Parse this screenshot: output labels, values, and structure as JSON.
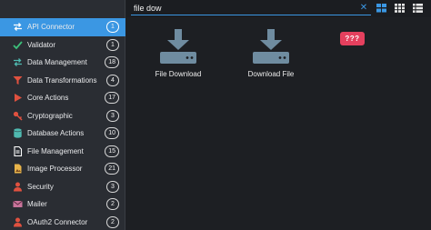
{
  "sidebar": {
    "items": [
      {
        "label": "API Connector",
        "count": "1",
        "icon": "swap-arrows-icon",
        "color": "#ffffff",
        "active": true
      },
      {
        "label": "Validator",
        "count": "1",
        "icon": "checkmark-icon",
        "color": "#3cbf7a"
      },
      {
        "label": "Data Management",
        "count": "18",
        "icon": "swap-arrows-icon",
        "color": "#4fb9b0"
      },
      {
        "label": "Data Transformations",
        "count": "4",
        "icon": "funnel-icon",
        "color": "#e0513f"
      },
      {
        "label": "Core Actions",
        "count": "17",
        "icon": "play-icon",
        "color": "#e0513f"
      },
      {
        "label": "Cryptographic",
        "count": "3",
        "icon": "key-icon",
        "color": "#e0513f"
      },
      {
        "label": "Database Actions",
        "count": "10",
        "icon": "database-icon",
        "color": "#4fb9b0"
      },
      {
        "label": "File Management",
        "count": "15",
        "icon": "file-icon",
        "color": "#ffffff"
      },
      {
        "label": "Image Processor",
        "count": "21",
        "icon": "image-file-icon",
        "color": "#e8b44a"
      },
      {
        "label": "Security",
        "count": "3",
        "icon": "user-icon",
        "color": "#e0513f"
      },
      {
        "label": "Mailer",
        "count": "2",
        "icon": "envelope-icon",
        "color": "#c8739a"
      },
      {
        "label": "OAuth2 Connector",
        "count": "2",
        "icon": "user-icon",
        "color": "#e0513f"
      }
    ]
  },
  "search": {
    "value": "file dow",
    "clear_icon": "close-icon"
  },
  "views": [
    "grid-large-icon",
    "grid-small-icon",
    "list-icon"
  ],
  "results": [
    {
      "label": "File Download",
      "icon": "download-icon"
    },
    {
      "label": "Download File",
      "icon": "download-icon"
    }
  ],
  "badge": {
    "text": "???",
    "color": "#e5405e"
  },
  "colors": {
    "accent": "#3b97e3",
    "icon_steel": "#6f8ca0"
  }
}
